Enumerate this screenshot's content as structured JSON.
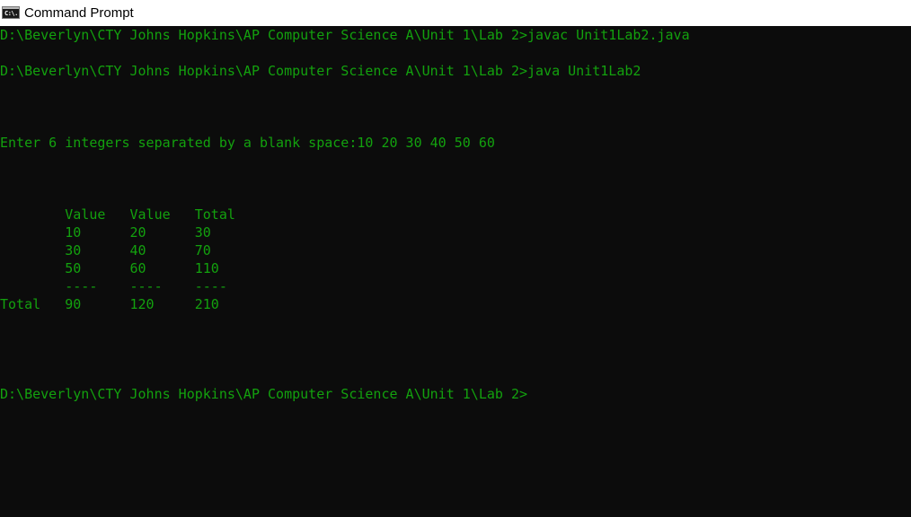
{
  "window": {
    "title": "Command Prompt",
    "icon": "cmd-icon",
    "icon_text": "C:\\."
  },
  "console": {
    "text_color": "#13a10e",
    "background": "#0c0c0c",
    "lines": [
      "D:\\Beverlyn\\CTY Johns Hopkins\\AP Computer Science A\\Unit 1\\Lab 2>javac Unit1Lab2.java",
      "D:\\Beverlyn\\CTY Johns Hopkins\\AP Computer Science A\\Unit 1\\Lab 2>java Unit1Lab2",
      "Enter 6 integers separated by a blank space:10 20 30 40 50 60",
      "        Value   Value   Total",
      "        10      20      30",
      "        30      40      70",
      "        50      60      110",
      "        ----    ----    ----",
      "Total   90      120     210",
      "D:\\Beverlyn\\CTY Johns Hopkins\\AP Computer Science A\\Unit 1\\Lab 2>"
    ]
  }
}
